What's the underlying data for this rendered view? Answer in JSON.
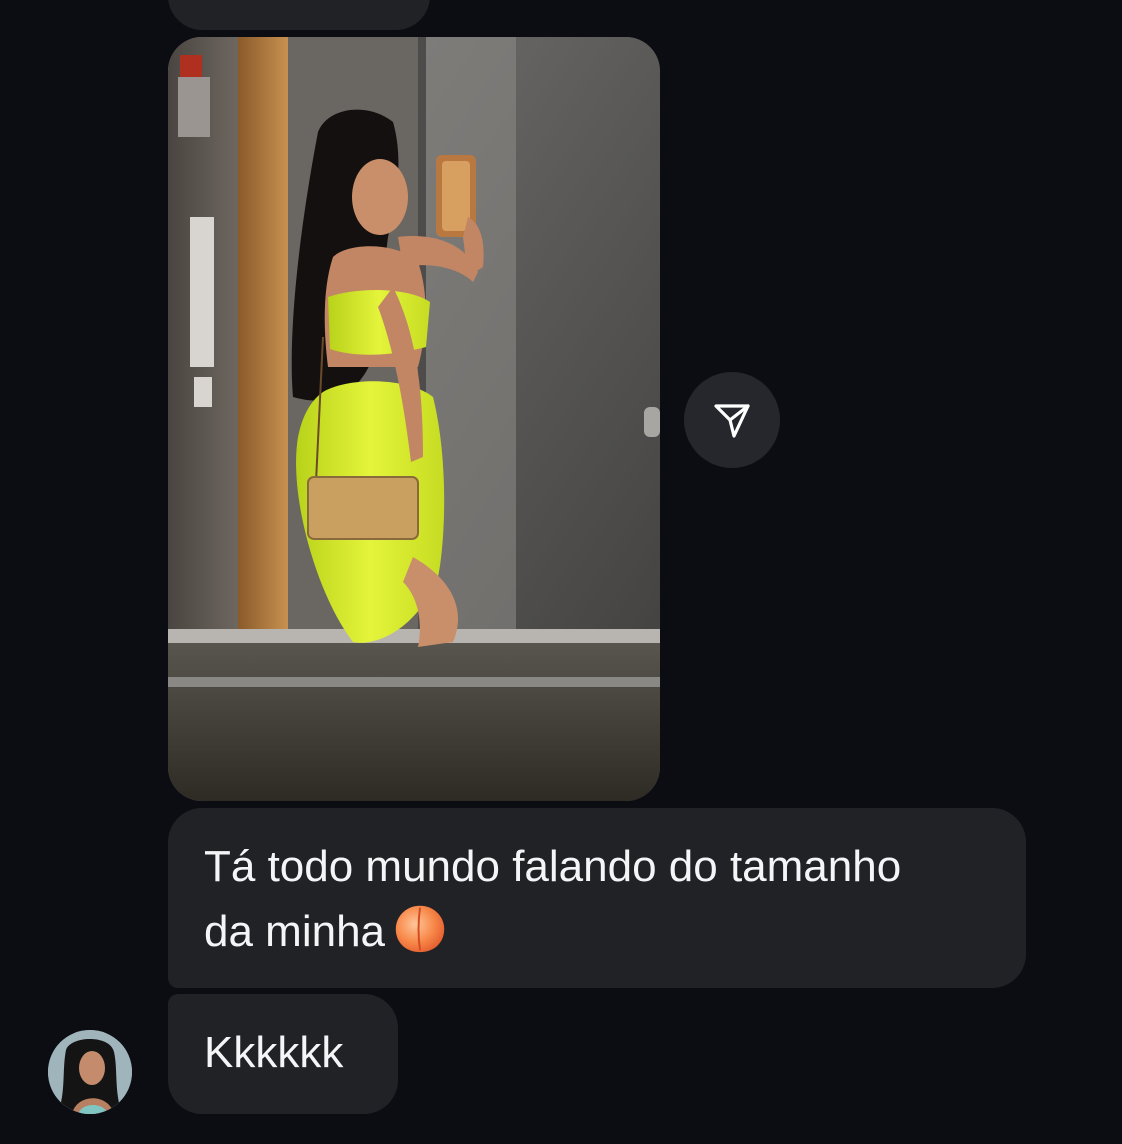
{
  "conversation": {
    "messages": [
      {
        "type": "photo",
        "description_icon": "elevator-selfie-photo"
      },
      {
        "type": "text",
        "text_line1": "Tá todo mundo falando do tamanho",
        "text_line2": "da minha",
        "emoji": "peach-emoji"
      },
      {
        "type": "text",
        "text": "Kkkkkk"
      }
    ],
    "share_icon": "send-icon",
    "avatar_icon": "sender-avatar"
  },
  "colors": {
    "background": "#0b0d13",
    "bubble": "#202226",
    "text": "#f4f5f7",
    "share_button": "#25272c"
  }
}
